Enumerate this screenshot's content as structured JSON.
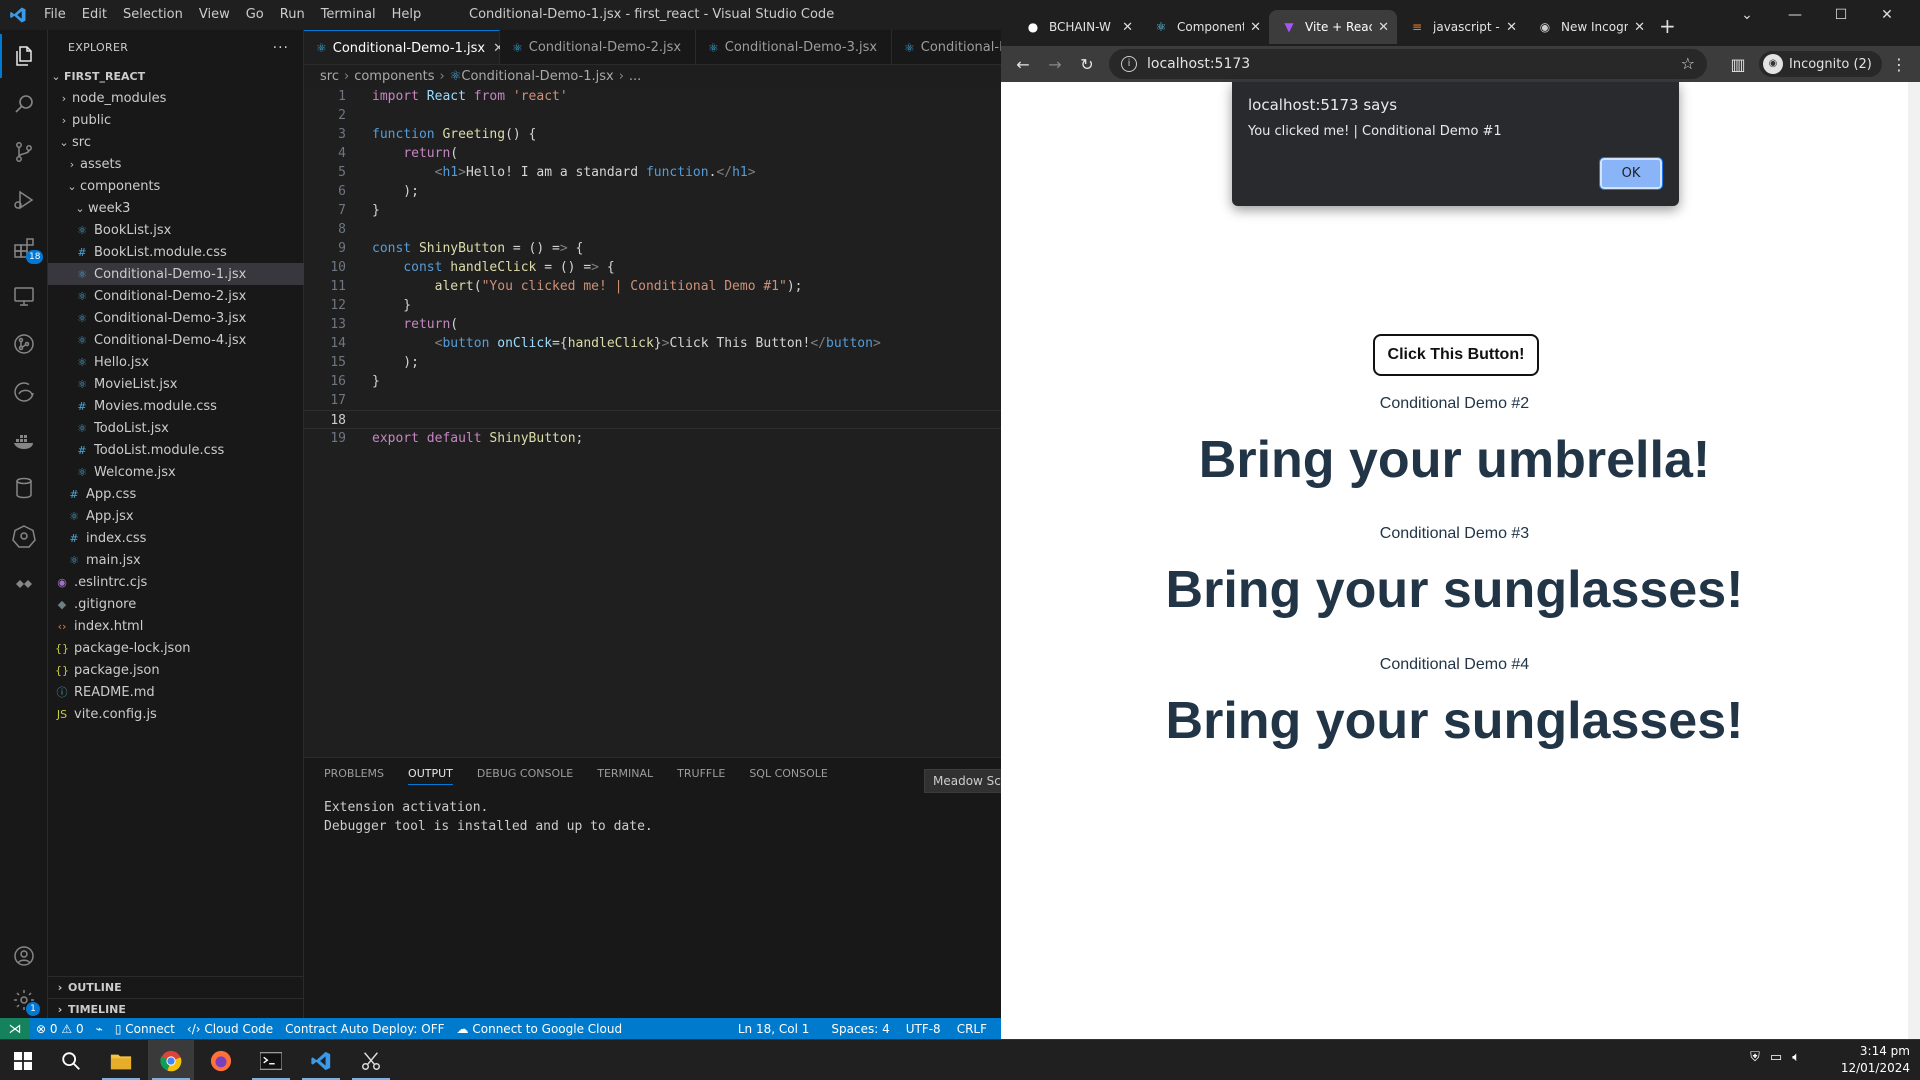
{
  "vscode": {
    "window_title": "Conditional-Demo-1.jsx - first_react - Visual Studio Code",
    "menu": [
      "File",
      "Edit",
      "Selection",
      "View",
      "Go",
      "Run",
      "Terminal",
      "Help"
    ],
    "activity_bar": {
      "icons": [
        "explorer-icon",
        "search-icon",
        "source-control-icon",
        "run-debug-icon",
        "extensions-icon",
        "remote-explorer-icon",
        "git-lens-icon",
        "edge-devtools-icon",
        "docker-icon",
        "database-icon",
        "kubernetes-icon",
        "live-share-icon",
        "account-icon",
        "settings-gear-icon"
      ],
      "extensions_badge": "18",
      "settings_badge": "1"
    },
    "explorer": {
      "header": "EXPLORER",
      "root": "FIRST_REACT",
      "items": [
        {
          "label": "node_modules",
          "depth": 1,
          "type": "folder",
          "expanded": false
        },
        {
          "label": "public",
          "depth": 1,
          "type": "folder",
          "expanded": false
        },
        {
          "label": "src",
          "depth": 1,
          "type": "folder",
          "expanded": true
        },
        {
          "label": "assets",
          "depth": 2,
          "type": "folder",
          "expanded": false
        },
        {
          "label": "components",
          "depth": 2,
          "type": "folder",
          "expanded": true
        },
        {
          "label": "week3",
          "depth": 3,
          "type": "folder",
          "expanded": true
        },
        {
          "label": "BookList.jsx",
          "depth": 3,
          "type": "react"
        },
        {
          "label": "BookList.module.css",
          "depth": 3,
          "type": "css"
        },
        {
          "label": "Conditional-Demo-1.jsx",
          "depth": 3,
          "type": "react",
          "selected": true
        },
        {
          "label": "Conditional-Demo-2.jsx",
          "depth": 3,
          "type": "react"
        },
        {
          "label": "Conditional-Demo-3.jsx",
          "depth": 3,
          "type": "react"
        },
        {
          "label": "Conditional-Demo-4.jsx",
          "depth": 3,
          "type": "react"
        },
        {
          "label": "Hello.jsx",
          "depth": 3,
          "type": "react"
        },
        {
          "label": "MovieList.jsx",
          "depth": 3,
          "type": "react"
        },
        {
          "label": "Movies.module.css",
          "depth": 3,
          "type": "css"
        },
        {
          "label": "TodoList.jsx",
          "depth": 3,
          "type": "react"
        },
        {
          "label": "TodoList.module.css",
          "depth": 3,
          "type": "css"
        },
        {
          "label": "Welcome.jsx",
          "depth": 3,
          "type": "react"
        },
        {
          "label": "App.css",
          "depth": 2,
          "type": "css"
        },
        {
          "label": "App.jsx",
          "depth": 2,
          "type": "react"
        },
        {
          "label": "index.css",
          "depth": 2,
          "type": "css"
        },
        {
          "label": "main.jsx",
          "depth": 2,
          "type": "react"
        },
        {
          "label": ".eslintrc.cjs",
          "depth": 1,
          "type": "eslint"
        },
        {
          "label": ".gitignore",
          "depth": 1,
          "type": "git"
        },
        {
          "label": "index.html",
          "depth": 1,
          "type": "html"
        },
        {
          "label": "package-lock.json",
          "depth": 1,
          "type": "json"
        },
        {
          "label": "package.json",
          "depth": 1,
          "type": "json"
        },
        {
          "label": "README.md",
          "depth": 1,
          "type": "info"
        },
        {
          "label": "vite.config.js",
          "depth": 1,
          "type": "js"
        }
      ],
      "outline": "OUTLINE",
      "timeline": "TIMELINE"
    },
    "tabs": [
      {
        "label": "Conditional-Demo-1.jsx",
        "active": true
      },
      {
        "label": "Conditional-Demo-2.jsx",
        "active": false
      },
      {
        "label": "Conditional-Demo-3.jsx",
        "active": false
      },
      {
        "label": "Conditional-D",
        "active": false
      }
    ],
    "breadcrumb": [
      "src",
      "components",
      "Conditional-Demo-1.jsx",
      "..."
    ],
    "code_lines": [
      "import React from 'react'",
      "",
      "function Greeting() {",
      "    return(",
      "        <h1>Hello! I am a standard function.</h1>",
      "    );",
      "}",
      "",
      "const ShinyButton = () => {",
      "    const handleClick = () => {",
      "        alert(\"You clicked me! | Conditional Demo #1\");",
      "    }",
      "    return(",
      "        <button onClick={handleClick}>Click This Button!</button>",
      "    );",
      "}",
      "",
      "",
      "export default ShinyButton;"
    ],
    "current_line": 18,
    "panel": {
      "tabs": [
        "PROBLEMS",
        "OUTPUT",
        "DEBUG CONSOLE",
        "TERMINAL",
        "TRUFFLE",
        "SQL CONSOLE"
      ],
      "active_tab": "OUTPUT",
      "channel": "Meadow Sc",
      "output": [
        "Extension activation.",
        "Debugger tool is installed and up to date."
      ]
    },
    "status": {
      "errors": "0",
      "warnings": "0",
      "connect": "Connect",
      "cloud_code": "Cloud Code",
      "contract": "Contract Auto Deploy: OFF",
      "google_cloud": "Connect to Google Cloud",
      "position": "Ln 18, Col 1",
      "spaces": "Spaces: 4",
      "encoding": "UTF-8",
      "eol": "CRLF"
    }
  },
  "chrome": {
    "tabs": [
      {
        "label": "BCHAIN-W",
        "icon": "github-icon",
        "active": false
      },
      {
        "label": "Component",
        "icon": "react-icon",
        "active": false
      },
      {
        "label": "Vite + React",
        "icon": "vite-icon",
        "active": true
      },
      {
        "label": "javascript -",
        "icon": "stackoverflow-icon",
        "active": false
      },
      {
        "label": "New Incogn",
        "icon": "incognito-icon",
        "active": false
      }
    ],
    "url": "localhost:5173",
    "incognito_label": "Incognito (2)",
    "dialog": {
      "title": "localhost:5173 says",
      "message": "You clicked me! | Conditional Demo #1",
      "ok": "OK"
    },
    "page": {
      "button_label": "Click This Button!",
      "demo2_label": "Conditional Demo #2",
      "demo2_heading": "Bring your umbrella!",
      "demo3_label": "Conditional Demo #3",
      "demo3_heading": "Bring your sunglasses!",
      "demo4_label": "Conditional Demo #4",
      "demo4_heading": "Bring your sunglasses!"
    }
  },
  "taskbar": {
    "apps": [
      "windows-start-icon",
      "search-icon",
      "file-explorer-icon",
      "chrome-icon",
      "firefox-icon",
      "terminal-icon",
      "vscode-icon",
      "snipping-tool-icon"
    ],
    "time": "3:14 pm",
    "date": "12/01/2024"
  }
}
